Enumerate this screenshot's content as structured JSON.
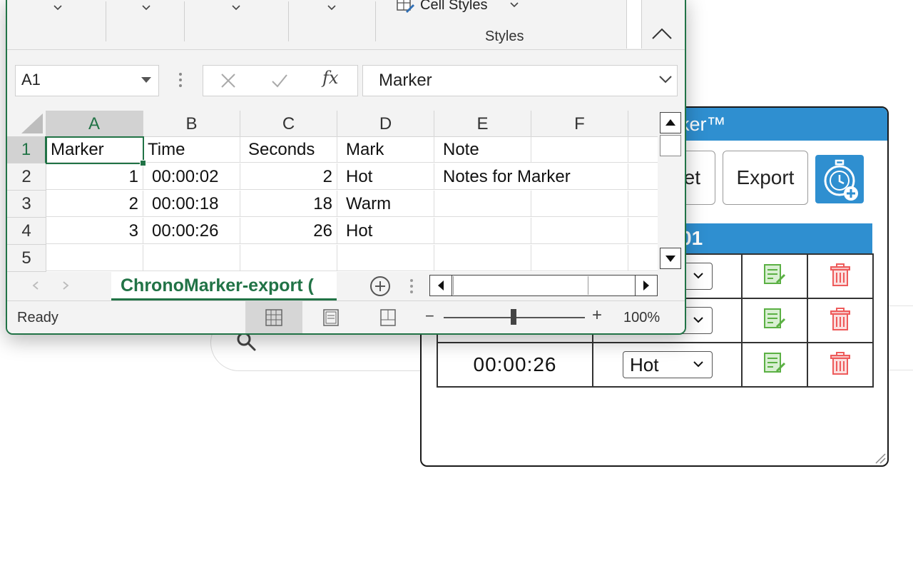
{
  "excel": {
    "ribbon": {
      "cell_styles_label": "Cell Styles",
      "group_label": "Styles"
    },
    "formula_bar": {
      "name_box": "A1",
      "fx_label": "fx",
      "content": "Marker"
    },
    "columns": [
      "A",
      "B",
      "C",
      "D",
      "E",
      "F"
    ],
    "rows": [
      {
        "num": "1",
        "cells": [
          "Marker",
          "Time",
          "Seconds",
          "Mark",
          "Note",
          ""
        ]
      },
      {
        "num": "2",
        "cells": [
          "1",
          "00:00:02",
          "2",
          "Hot",
          "Notes for Marker",
          ""
        ]
      },
      {
        "num": "3",
        "cells": [
          "2",
          "00:00:18",
          "18",
          "Warm",
          "",
          ""
        ]
      },
      {
        "num": "4",
        "cells": [
          "3",
          "00:00:26",
          "26",
          "Hot",
          "",
          ""
        ]
      },
      {
        "num": "5",
        "cells": [
          "",
          "",
          "",
          "",
          "",
          ""
        ]
      }
    ],
    "sheet_tab": "ChronoMarker-export (",
    "status": "Ready",
    "zoom_minus": "−",
    "zoom_plus": "+",
    "zoom": "100%",
    "accent_color": "#217346"
  },
  "chronomarker": {
    "title_visible": "ker™",
    "reset_label_visible": "et",
    "export_label": "Export",
    "session_visible": "01",
    "rows": [
      {
        "time": "",
        "mark": ""
      },
      {
        "time": "",
        "mark": ""
      },
      {
        "time": "00:00:26",
        "mark": "Hot"
      }
    ],
    "accent_color": "#2f8fd0"
  }
}
